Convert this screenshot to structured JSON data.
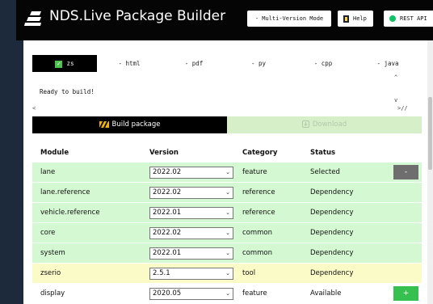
{
  "header": {
    "title": "NDS.Live Package Builder",
    "buttons": {
      "mode": "- Multi-Version Mode",
      "help": "Help",
      "rest": "REST API"
    }
  },
  "tabs": [
    {
      "label": "zs",
      "active": true
    },
    {
      "label": "- html"
    },
    {
      "label": "- pdf"
    },
    {
      "label": "- py"
    },
    {
      "label": "- cpp"
    },
    {
      "label": "- java"
    }
  ],
  "log": {
    "text": "Ready to build!"
  },
  "actions": {
    "build": "Build package",
    "download": "Download"
  },
  "table": {
    "headers": [
      "Module",
      "Version",
      "Category",
      "Status"
    ],
    "rows": [
      {
        "module": "lane",
        "version": "2022.02",
        "category": "feature",
        "status": "Selected",
        "action": "-"
      },
      {
        "module": "lane.reference",
        "version": "2022.02",
        "category": "reference",
        "status": "Dependency"
      },
      {
        "module": "vehicle.reference",
        "version": "2022.01",
        "category": "reference",
        "status": "Dependency"
      },
      {
        "module": "core",
        "version": "2022.02",
        "category": "common",
        "status": "Dependency"
      },
      {
        "module": "system",
        "version": "2022.01",
        "category": "common",
        "status": "Dependency"
      },
      {
        "module": "zserio",
        "version": "2.5.1",
        "category": "tool",
        "status": "Dependency"
      },
      {
        "module": "display",
        "version": "2020.05",
        "category": "feature",
        "status": "Available",
        "action": "+"
      }
    ]
  },
  "colors": {
    "selected_row": "#d4f8d2",
    "dependency_row": "#d4f8d2",
    "tool_row": "#fbfbc8",
    "add_button": "#36c04f",
    "remove_button": "#6e6e6e",
    "header_bg": "#050505",
    "page_bg": "#1d2a3b"
  },
  "icons": {
    "logo": "nds-logo-icon",
    "help": "book-icon",
    "rest": "status-dot-icon",
    "build": "hazard-stripes-icon",
    "download": "download-icon"
  }
}
